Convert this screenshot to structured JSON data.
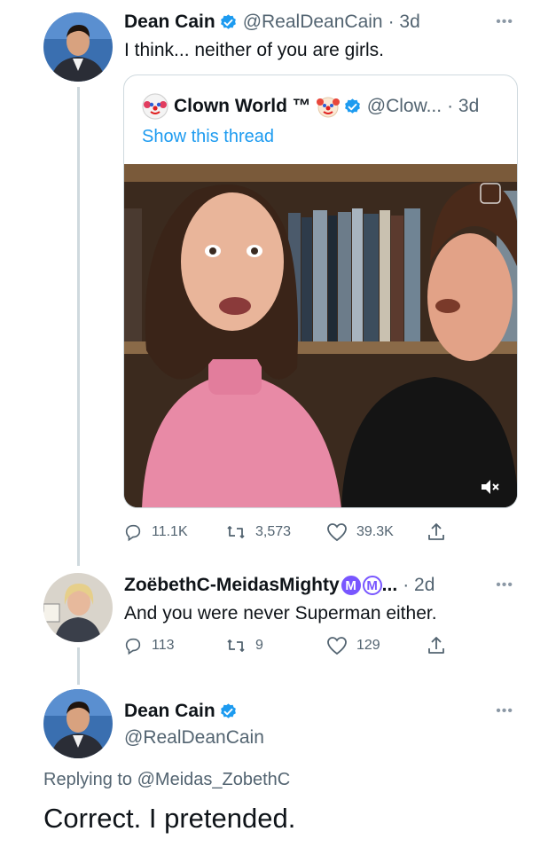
{
  "tweet1": {
    "name": "Dean Cain",
    "handle": "@RealDeanCain",
    "time": "· 3d",
    "text": "I think... neither of you are girls."
  },
  "quote": {
    "name": "Clown World ™",
    "handle": "@Clow...",
    "time": "· 3d",
    "show_thread": "Show this thread"
  },
  "tweet1_actions": {
    "replies": "11.1K",
    "retweets": "3,573",
    "likes": "39.3K"
  },
  "tweet2": {
    "name": "ZoëbethC-MeidasMighty",
    "badge1": "M",
    "badge2": "M",
    "ellipsis": "...",
    "time": "· 2d",
    "text": "And you were never Superman either.",
    "replies": "113",
    "retweets": "9",
    "likes": "129"
  },
  "tweet3": {
    "name": "Dean Cain",
    "handle": "@RealDeanCain",
    "replying_prefix": "Replying to",
    "replying_to": "@Meidas_ZobethC",
    "text": "Correct. I pretended."
  },
  "more_label": "•••",
  "colors": {
    "accent": "#1d9bf0",
    "muted": "#536471",
    "divider": "#cfd9de",
    "badge_purple": "#7856ff"
  },
  "icons": [
    "verified-icon",
    "reply-icon",
    "retweet-icon",
    "like-icon",
    "share-icon",
    "more-icon",
    "mute-icon",
    "clown-icon"
  ]
}
